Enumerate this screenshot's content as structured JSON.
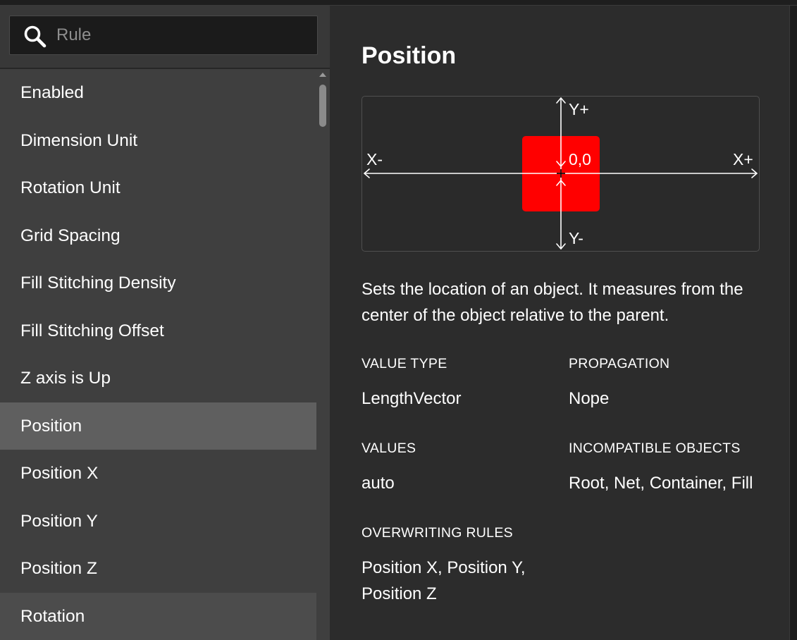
{
  "search": {
    "placeholder": "Rule",
    "value": ""
  },
  "rules": [
    {
      "label": "Enabled",
      "state": "normal"
    },
    {
      "label": "Dimension Unit",
      "state": "normal"
    },
    {
      "label": "Rotation Unit",
      "state": "normal"
    },
    {
      "label": "Grid Spacing",
      "state": "normal"
    },
    {
      "label": "Fill Stitching Density",
      "state": "normal"
    },
    {
      "label": "Fill Stitching Offset",
      "state": "normal"
    },
    {
      "label": "Z axis is Up",
      "state": "normal"
    },
    {
      "label": "Position",
      "state": "selected"
    },
    {
      "label": "Position X",
      "state": "normal"
    },
    {
      "label": "Position Y",
      "state": "normal"
    },
    {
      "label": "Position Z",
      "state": "normal"
    },
    {
      "label": "Rotation",
      "state": "hover"
    }
  ],
  "detail": {
    "title": "Position",
    "diagram": {
      "y_plus": "Y+",
      "y_minus": "Y-",
      "x_minus": "X-",
      "x_plus": "X+",
      "origin": "0,0",
      "object_color": "#ff0000"
    },
    "description": "Sets the location of an object. It measures from the center of the object relative to the parent.",
    "value_type": {
      "label": "VALUE TYPE",
      "value": "LengthVector"
    },
    "propagation": {
      "label": "PROPAGATION",
      "value": "Nope"
    },
    "values": {
      "label": "VALUES",
      "value": "auto"
    },
    "incompatible_objects": {
      "label": "INCOMPATIBLE OBJECTS",
      "value": "Root, Net, Container, Fill"
    },
    "overwriting_rules": {
      "label": "OVERWRITING RULES",
      "value": "Position X, Position Y, Position Z"
    }
  },
  "colors": {
    "list_background": "#3f3f3f",
    "selected_row": "#5f5f5f",
    "detail_background": "#2c2c2c",
    "search_background": "#1b1b1b"
  }
}
